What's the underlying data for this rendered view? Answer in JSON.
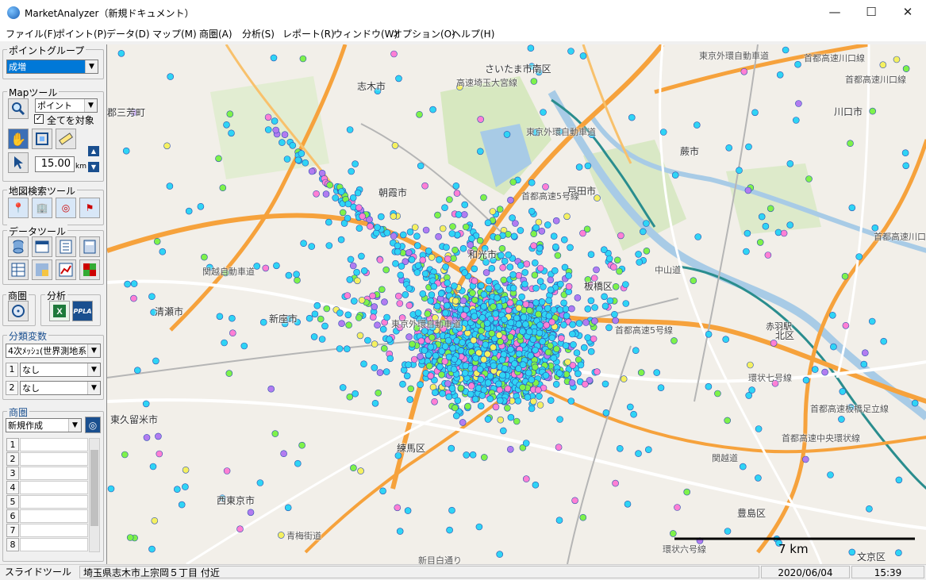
{
  "window": {
    "title": "MarketAnalyzer（新規ドキュメント）",
    "min_icon": "minimize-icon",
    "max_icon": "maximize-icon",
    "close_icon": "close-icon"
  },
  "menu": [
    "ファイル(F)",
    "ポイント(P)",
    "データ(D)",
    "マップ(M)",
    "商圏(A)",
    "分析(S)",
    "レポート(R)",
    "ウィンドウ(W)",
    "オプション(O)",
    "ヘルプ(H)"
  ],
  "sidebar": {
    "point_group": {
      "title": "ポイントグループ",
      "value": "成増"
    },
    "map_tools": {
      "title": "Mapツール",
      "select_value": "ポイント",
      "all_target_label": "全てを対象",
      "all_target_checked": true,
      "distance_value": "15.00",
      "distance_unit": "km"
    },
    "map_search": {
      "title": "地図検索ツール"
    },
    "data_tools": {
      "title": "データツール"
    },
    "shoken_tools": {
      "title": "商圏"
    },
    "analysis_tools": {
      "title": "分析",
      "ppla_label": "PPLA"
    },
    "class_vars": {
      "title": "分類変数",
      "main_value": "4次ﾒｯｼｭ(世界測地系",
      "row1_num": "1",
      "row1_value": "なし",
      "row2_num": "2",
      "row2_value": "なし"
    },
    "shoken": {
      "title": "商圏",
      "value": "新規作成",
      "rows": [
        "1",
        "2",
        "3",
        "4",
        "5",
        "6",
        "7",
        "8"
      ]
    }
  },
  "map": {
    "labels": {
      "shiki": "志木市",
      "asaka": "朝霞市",
      "wako": "和光市",
      "toda": "戸田市",
      "warabi": "蕨市",
      "kawaguchi": "川口市",
      "saitama_minami": "さいたま市南区",
      "itabashi": "板橋区",
      "kita": "北区",
      "niiza": "新座市",
      "kiyose": "清瀬市",
      "higashikurume": "東久留米市",
      "nishitokyo": "西東京市",
      "nerima": "練馬区",
      "toshima": "豊島区",
      "bunkyo": "文京区",
      "miyoshi": "郡三芳町",
      "akabane": "赤羽駅"
    },
    "roads": {
      "gaikan_top": "東京外環自動車道",
      "gaikan_mid": "東京外環自動車道",
      "gaikan_bottom": "東京外環自動車道",
      "saitama_ohmiya": "高速埼玉大宮線",
      "shutoko_kawaguchi": "首都高速川口線",
      "shutoko_kawaguchi2": "首都高速川口線",
      "shutoko_kawaguchi3": "首都高速川口線",
      "shutoko5": "首都高速5号線",
      "shutoko5b": "首都高速5号線",
      "shutoko_itabashi": "首都高速板橋足立線",
      "shutoko_central": "首都高速中央環状線",
      "kanjo7": "環状七号線",
      "kanjo6": "環状六号線",
      "kanetsu": "関越自動車道",
      "kanetsu2": "関越道",
      "nakasen": "中山道",
      "ome": "青梅街道",
      "shinmei": "新目白通り"
    },
    "scale_label": "7 km",
    "point_colors": [
      "#2fd4f5",
      "#7ef24a",
      "#ff7fd4",
      "#b27cf0",
      "#f5f060"
    ]
  },
  "status": {
    "tool": "スライドツール",
    "location": "埼玉県志木市上宗岡５丁目 付近",
    "date": "2020/06/04",
    "time": "15:39"
  }
}
